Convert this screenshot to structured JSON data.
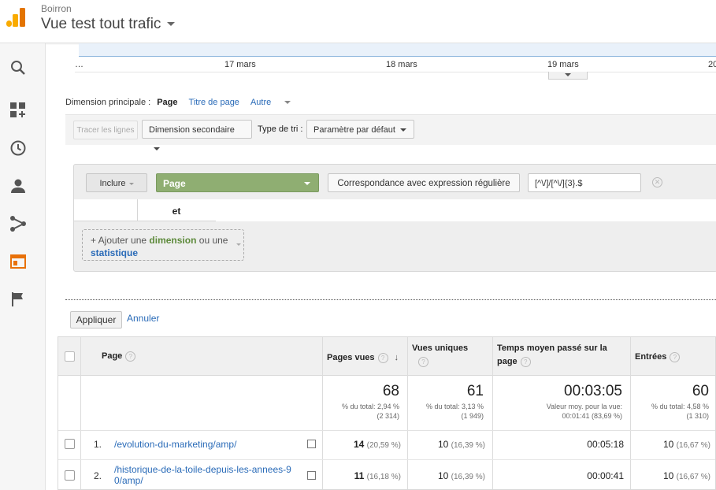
{
  "header": {
    "account": "Boirron",
    "view": "Vue test tout trafic"
  },
  "sidebar": {
    "icons": [
      "search-icon",
      "dashboard-icon",
      "clock-icon",
      "person-icon",
      "share-icon",
      "window-icon",
      "flag-icon"
    ]
  },
  "chart": {
    "ticks": [
      "…",
      "17 mars",
      "18 mars",
      "19 mars",
      "20"
    ]
  },
  "dimension": {
    "label": "Dimension principale :",
    "active": "Page",
    "options": [
      "Titre de page",
      "Autre"
    ]
  },
  "toolbar": {
    "trace": "Tracer les lignes",
    "secondary": "Dimension secondaire",
    "sort_label": "Type de tri :",
    "sort_value": "Paramètre par défaut"
  },
  "filter": {
    "include": "Inclure",
    "dimension": "Page",
    "match": "Correspondance avec expression régulière",
    "regex": "[^\\/]/[^\\/]{3}.$",
    "et": "et",
    "add_prefix": "+ Ajouter une",
    "add_dimension": "dimension",
    "add_or": "ou une",
    "add_stat": "statistique"
  },
  "actions": {
    "apply": "Appliquer",
    "cancel": "Annuler"
  },
  "table": {
    "headers": {
      "page": "Page",
      "pages_vues": "Pages vues",
      "vues_uniques": "Vues uniques",
      "temps_line1": "Temps moyen passé sur la",
      "temps_line2": "page",
      "entrees": "Entrées"
    },
    "totals": {
      "pages_vues": "68",
      "pages_vues_pct": "% du total: 2,94 %",
      "pages_vues_total": "(2 314)",
      "vues_uniques": "61",
      "vues_uniques_pct": "% du total: 3,13 %",
      "vues_uniques_total": "(1 949)",
      "temps": "00:03:05",
      "temps_l1": "Valeur moy. pour la vue:",
      "temps_l2": "00:01:41 (83,69 %)",
      "entrees": "60",
      "entrees_pct": "% du total: 4,58 %",
      "entrees_total": "(1 310)"
    },
    "rows": [
      {
        "index": "1.",
        "page_l1": "/evolution-du-marketing/amp/",
        "page_l2": "",
        "pv": "14",
        "pv_pct": "(20,59 %)",
        "vu": "10",
        "vu_pct": "(16,39 %)",
        "temps": "00:05:18",
        "ent": "10",
        "ent_pct": "(16,67 %)"
      },
      {
        "index": "2.",
        "page_l1": "/historique-de-la-toile-depuis-les-annees-9",
        "page_l2": "0/amp/",
        "pv": "11",
        "pv_pct": "(16,18 %)",
        "vu": "10",
        "vu_pct": "(16,39 %)",
        "temps": "00:00:41",
        "ent": "10",
        "ent_pct": "(16,67 %)"
      }
    ]
  }
}
